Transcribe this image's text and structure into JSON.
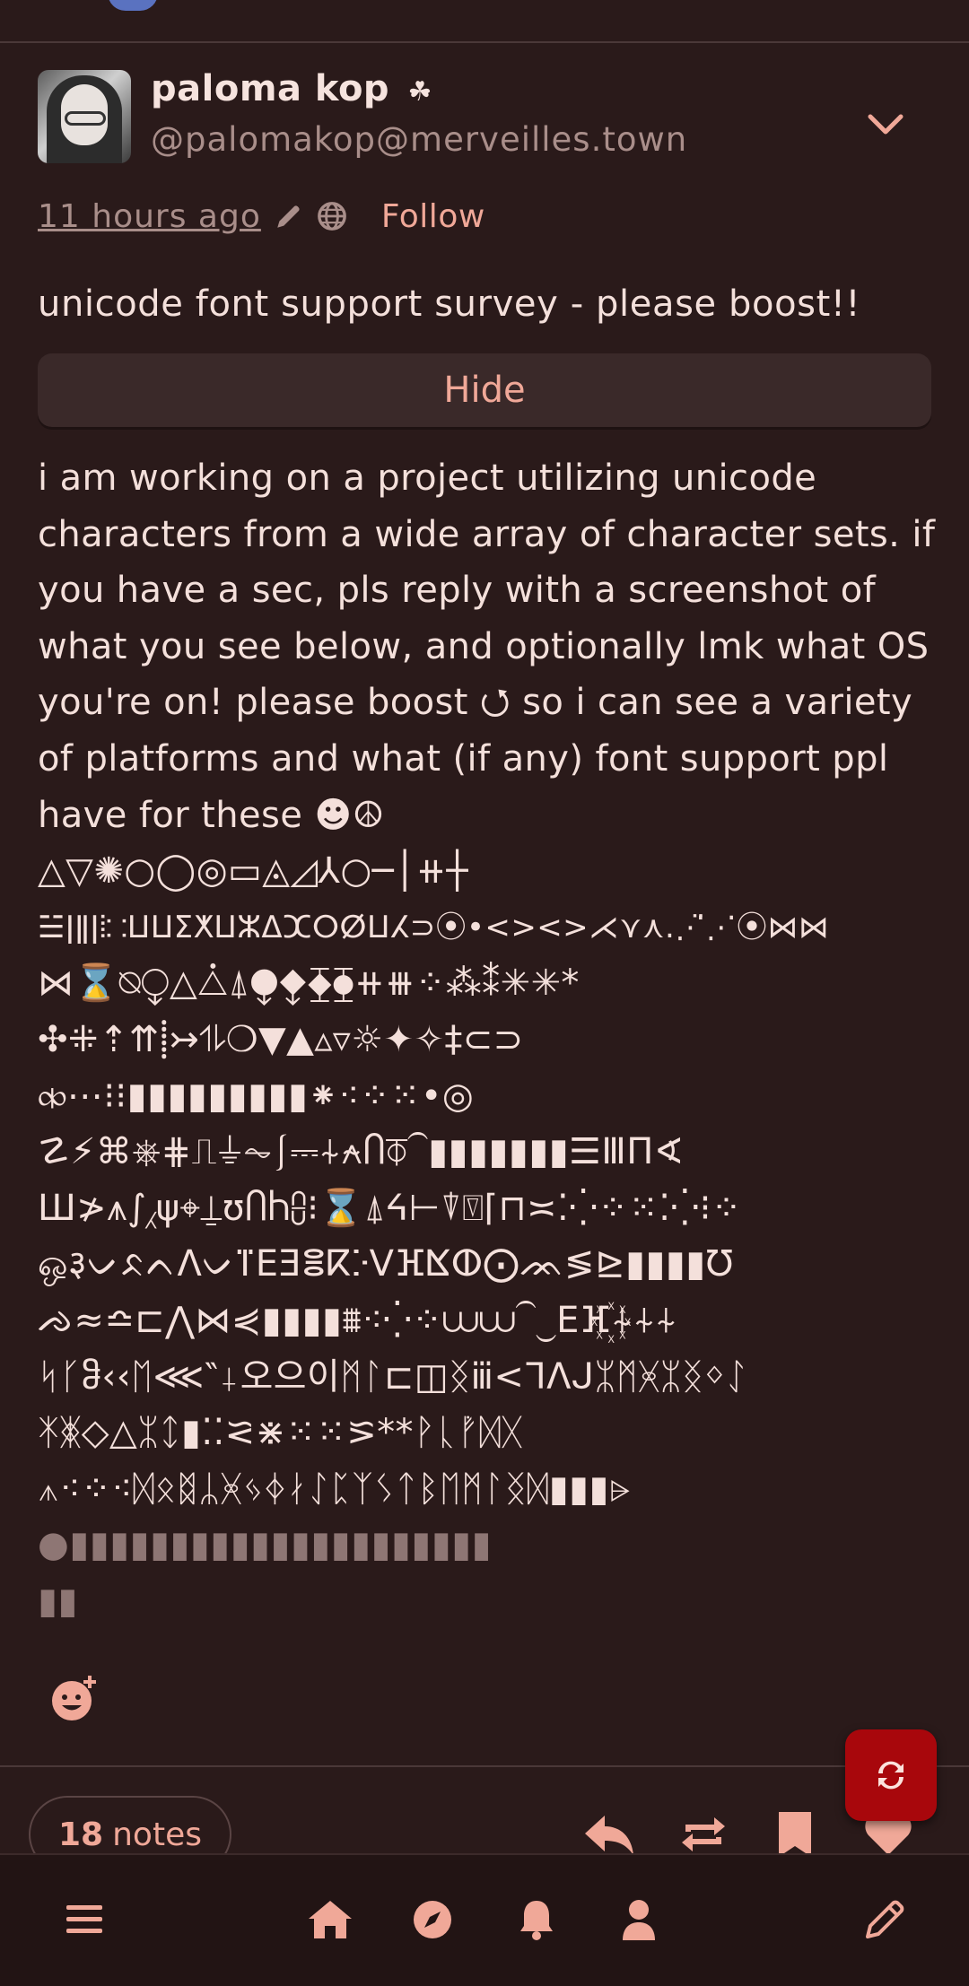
{
  "post": {
    "display_name": "paloma kop",
    "name_emoji": "☘",
    "handle": "@palomakop@merveilles.town",
    "time_ago": "11 hours ago",
    "follow_label": "Follow",
    "content_warning": "unicode font support survey - please boost!!",
    "hide_label": "Hide",
    "body_intro": "i am working on a project utilizing unicode characters from a wide array of character sets. if you have a sec, pls reply with a screenshot of what you see below, and optionally lmk what OS you're on! please boost ⭯ so i can see a variety of platforms and what (if any) font support ppl have for these ☻☮",
    "glyph_lines": [
      "△▽✺○◯◎▭◬◿⅄○─│⧺┼",
      "☱ǀǁǀ⦙⸬ⵡⵡⵉⵅⵡⵣⵠⵋⵔⵁⵡⵃ⊃⦿•<><>⋌⋎⋏.⋰̈⋰⦿⋈⋈",
      "⋈⌛⍉⧬△⧊⍋⧭⧪⧱⧳⧺⧻⁘⁂⁑✳✳*",
      "✣⁜⇡⇈⸽↣⥮❍▼▲▵▿☼✦✧‡⊂⊃",
      "⧞⋯⁝⁝▮▮▮▮▮▮▮▮▮⁕⁖⁘⁙•◎",
      "☡⚡⌘⎈⋕⎍⏚⏦⎰⎓⍭⍲Ⴖ⏁⏜▮▮▮▮▮▮▮☰ⅢΠ∢",
      "Ш≯⩚∫⁁ψ⌖⍊ʊႶႹ⩉⁝⌛⍋ᔦ⊢⍒⍔⌈⊓≍⁚⁛⁘⁙⁚⁛⁝⁘",
      "ஒ३ᨆᨅᨈⴷᨆⴶⴹⴺⴻⴽⴾⴸⴼⴿⵀ⨀ᨏ≶⊵▮▮▮▮Ʊ",
      "ᨌ≈≏⊏⋀⋈⋞▮▮▮▮⩩⁖⁛⁘⩊⩊⏜⏝ⴹⴼ꙰⍭⍭⍭",
      "ᛋᚴჵ‹‹ᛖ⋘‶⸸오으이ᛗᛚ⊏◫ᛝⅲ<ᒣᐱᒍᛯᛗᚸᛯᛝᛜᛇ",
      "ᛡᛤ◇△ᛯᛨ▮⁚⁚⪝⋇⁙⁙⪞**ᚹᚳᚡᛞᚷ",
      "⩚⁖⁘⁖ᛞᛟᛥᛦᚸᛃᛄᛅᛇᛈᛉᛊᛏᛒᛖᛗᛚᛝᛞ▮▮▮⩥",
      "●▮▮▮▮▮▮▮▮▮▮▮▮▮▮▮▮▮▮▮▮▮",
      "▮▮"
    ],
    "notes_count": "18",
    "notes_label": "notes"
  },
  "icons": {
    "name_badge": "clover-icon",
    "edited": "pencil-icon",
    "visibility": "globe-icon",
    "expand": "chevron-down-icon",
    "react": "add-reaction-icon",
    "reply": "reply-icon",
    "boost": "boost-icon",
    "bookmark": "bookmark-icon",
    "favorite": "heart-icon",
    "refresh": "refresh-icon"
  },
  "nav": {
    "items": [
      "menu-icon",
      "home-icon",
      "explore-icon",
      "notifications-icon",
      "profile-icon",
      "compose-icon"
    ]
  },
  "colors": {
    "background": "#2a1a1a",
    "accent": "#f0a898",
    "fab": "#a8070c"
  }
}
